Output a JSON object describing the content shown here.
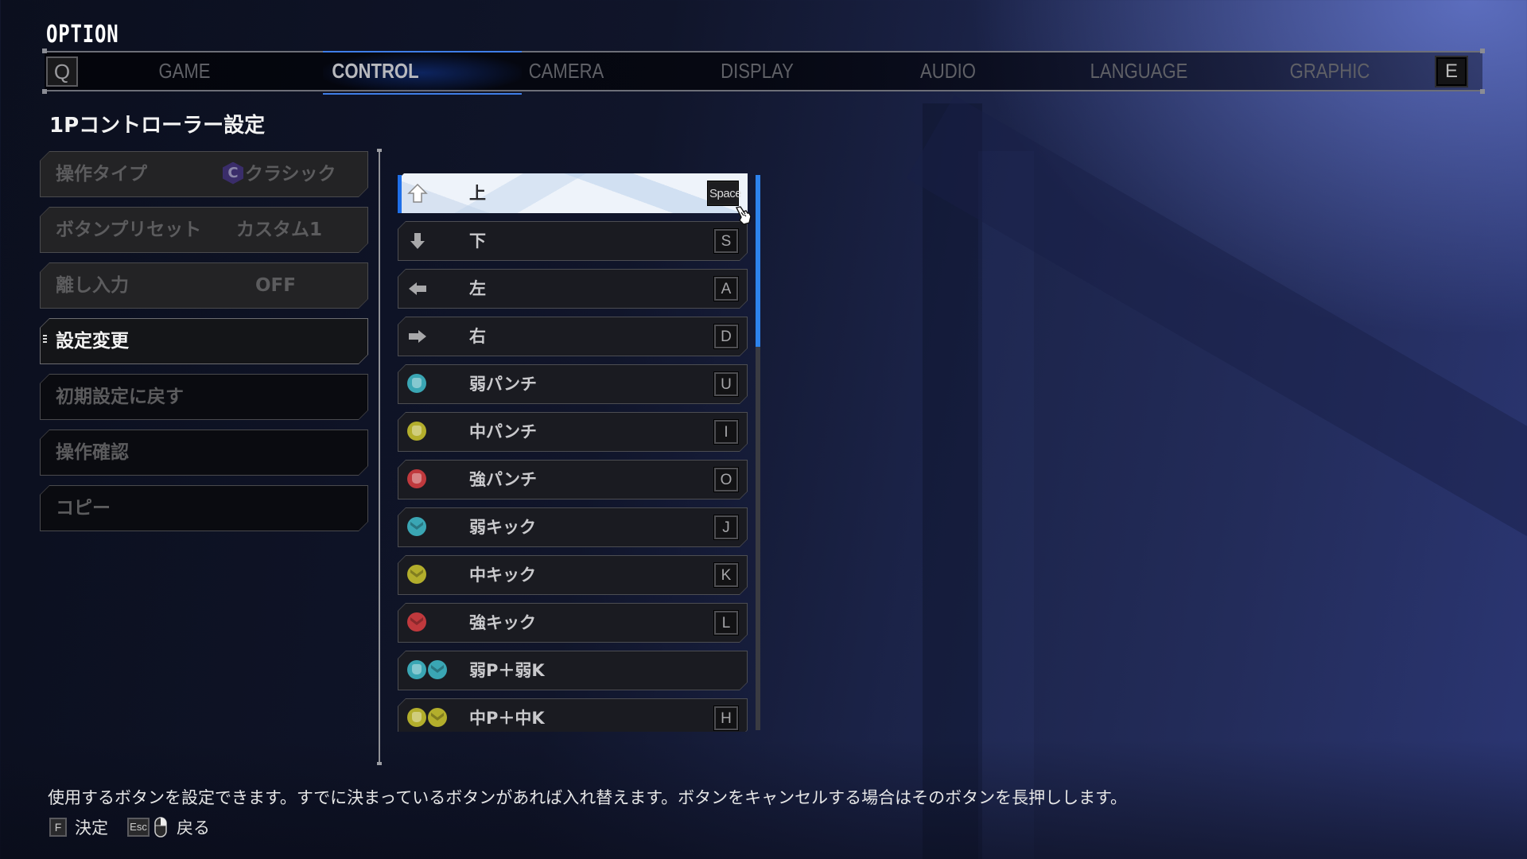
{
  "title": "OPTION",
  "tabs": {
    "prev_key": "Q",
    "next_key": "E",
    "items": [
      {
        "label": "GAME",
        "active": false
      },
      {
        "label": "CONTROL",
        "active": true
      },
      {
        "label": "CAMERA",
        "active": false
      },
      {
        "label": "DISPLAY",
        "active": false
      },
      {
        "label": "AUDIO",
        "active": false
      },
      {
        "label": "LANGUAGE",
        "active": false
      },
      {
        "label": "GRAPHIC",
        "active": false
      }
    ]
  },
  "section_title": "1Pコントローラー設定",
  "menu": [
    {
      "label": "操作タイプ",
      "value": "クラシック",
      "value_icon": "C",
      "state": "disabled"
    },
    {
      "label": "ボタンプリセット",
      "value": "カスタム1",
      "state": "disabled"
    },
    {
      "label": "離し入力",
      "value": "OFF",
      "state": "disabled"
    },
    {
      "label": "設定変更",
      "value": "",
      "state": "active"
    },
    {
      "label": "初期設定に戻す",
      "value": "",
      "state": "normal"
    },
    {
      "label": "操作確認",
      "value": "",
      "state": "normal"
    },
    {
      "label": "コピー",
      "value": "",
      "state": "normal"
    }
  ],
  "bindings": [
    {
      "action": "上",
      "icon": "arrow-up",
      "key": "Space",
      "selected": true
    },
    {
      "action": "下",
      "icon": "arrow-down",
      "key": "S"
    },
    {
      "action": "左",
      "icon": "arrow-left",
      "key": "A"
    },
    {
      "action": "右",
      "icon": "arrow-right",
      "key": "D"
    },
    {
      "action": "弱パンチ",
      "icon": "light-punch",
      "key": "U"
    },
    {
      "action": "中パンチ",
      "icon": "medium-punch",
      "key": "I"
    },
    {
      "action": "強パンチ",
      "icon": "heavy-punch",
      "key": "O"
    },
    {
      "action": "弱キック",
      "icon": "light-kick",
      "key": "J"
    },
    {
      "action": "中キック",
      "icon": "medium-kick",
      "key": "K"
    },
    {
      "action": "強キック",
      "icon": "heavy-kick",
      "key": "L"
    },
    {
      "action": "弱P＋弱K",
      "icon": "light-punch+light-kick",
      "key": ""
    },
    {
      "action": "中P＋中K",
      "icon": "medium-punch+medium-kick",
      "key": "H"
    }
  ],
  "scroll": {
    "thumb_fraction": 0.31
  },
  "colors": {
    "light": "#3aa6b4",
    "medium": "#b3ae2c",
    "heavy": "#c0393d",
    "accent": "#2d83ec"
  },
  "footer": {
    "hint": "使用するボタンを設定できます。すでに決まっているボタンがあれば入れ替えます。ボタンをキャンセルする場合はそのボタンを長押しします。",
    "confirm_key": "F",
    "confirm_label": "決定",
    "back_key": "Esc",
    "back_label": "戻る"
  }
}
